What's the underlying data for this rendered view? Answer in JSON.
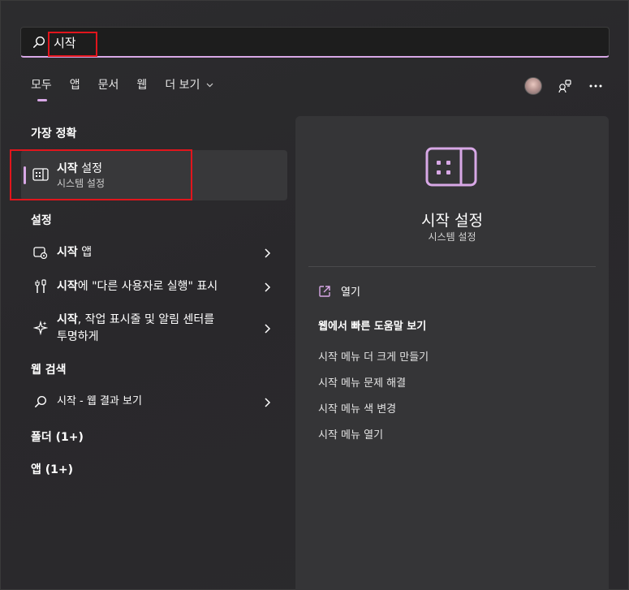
{
  "search": {
    "query": "시작"
  },
  "tabs": [
    {
      "label": "모두"
    },
    {
      "label": "앱"
    },
    {
      "label": "문서"
    },
    {
      "label": "웹"
    },
    {
      "label": "더 보기"
    }
  ],
  "left": {
    "best_match_heading": "가장 정확",
    "best_match": {
      "title_bold": "시작",
      "title_rest": " 설정",
      "subtitle": "시스템 설정"
    },
    "settings_heading": "설정",
    "settings_items": [
      {
        "bold": "시작",
        "rest": " 앱"
      },
      {
        "bold": "시작",
        "rest": "에 \"다른 사용자로 실행\" 표시"
      },
      {
        "bold": "시작",
        "rest": ", 작업 표시줄 및 알림 센터를",
        "rest2": "투명하게"
      }
    ],
    "web_heading": "웹 검색",
    "web_item": {
      "text": "시작 - 웹 결과 보기"
    },
    "folders": "폴더 (1+)",
    "apps": "앱 (1+)"
  },
  "detail": {
    "title": "시작 설정",
    "subtitle": "시스템 설정",
    "open_label": "열기",
    "help_heading": "웹에서 빠른 도움말 보기",
    "help_links": [
      "시작 메뉴 더 크게 만들기",
      "시작 메뉴 문제 해결",
      "시작 메뉴 색 변경",
      "시작 메뉴 열기"
    ]
  },
  "colors": {
    "accent": "#d8a8e6",
    "highlight": "#e1151c",
    "panel": "#353537"
  }
}
